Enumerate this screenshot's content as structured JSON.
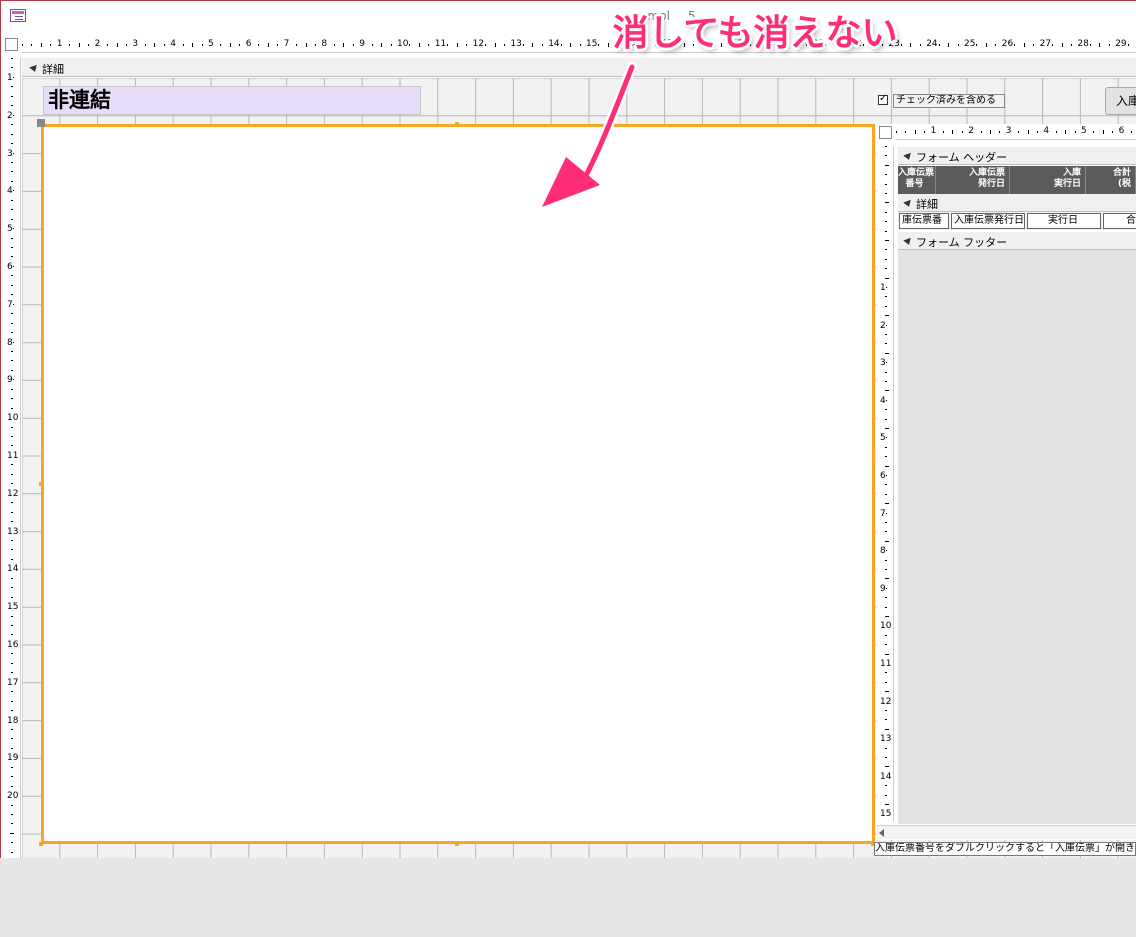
{
  "window": {
    "title": "ompl",
    "title_suffix": "5"
  },
  "designer": {
    "horizontal_ruler_labels": [
      "1",
      "2",
      "3",
      "4",
      "5",
      "6",
      "7",
      "8",
      "9",
      "10",
      "11",
      "12",
      "13",
      "14",
      "15",
      "16",
      "17",
      "18",
      "19",
      "20",
      "21",
      "22",
      "23",
      "24",
      "25",
      "26",
      "27",
      "28",
      "29"
    ],
    "vertical_ruler_labels": [
      "1",
      "2",
      "3",
      "4",
      "5",
      "6",
      "7",
      "8",
      "9",
      "10",
      "11",
      "12",
      "13",
      "14",
      "15",
      "16",
      "17",
      "18",
      "19",
      "20"
    ],
    "section_detail": "詳細",
    "label_unbound": "非連結",
    "checkbox_label": "チェック済みを含める",
    "checkbox_checked": true,
    "button_label": "入庫"
  },
  "subform": {
    "ruler_labels": [
      "1",
      "2",
      "3",
      "4",
      "5",
      "6"
    ],
    "vertical_ruler_labels": [
      "1",
      "2",
      "3",
      "4",
      "5",
      "6",
      "7",
      "8",
      "9",
      "10",
      "11",
      "12",
      "13",
      "14",
      "15"
    ],
    "section_header": "フォーム ヘッダー",
    "section_detail": "詳細",
    "section_footer": "フォーム フッター",
    "header_columns": [
      "入庫伝票\n番号",
      "入庫伝票\n発行日",
      "入庫\n実行日",
      "合計\n(税"
    ],
    "detail_columns": [
      "庫伝票番",
      "入庫伝票発行日",
      "実行日",
      "合計"
    ],
    "hint_text": "入庫伝票番号をダブルクリックすると「入庫伝票」が開きま"
  },
  "annotation": {
    "callout_text": "消しても消えない",
    "color": "#ff2d78"
  }
}
